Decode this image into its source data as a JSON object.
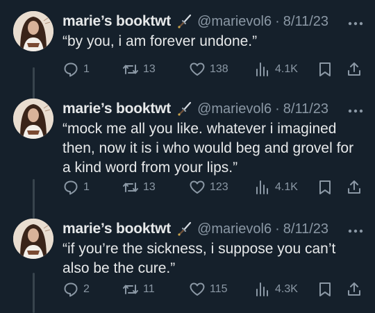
{
  "tweets": [
    {
      "display_name": "marie’s booktwt",
      "handle": "@marievol6",
      "separator": "·",
      "date": "8/11/23",
      "text": "“by you, i am forever undone.”",
      "replies": "1",
      "retweets": "13",
      "likes": "138",
      "views": "4.1K"
    },
    {
      "display_name": "marie’s booktwt",
      "handle": "@marievol6",
      "separator": "·",
      "date": "8/11/23",
      "text": "“mock me all you like. whatever i imagined then, now it is i who would beg and grovel for a kind word from your lips.”",
      "replies": "1",
      "retweets": "13",
      "likes": "123",
      "views": "4.1K"
    },
    {
      "display_name": "marie’s booktwt",
      "handle": "@marievol6",
      "separator": "·",
      "date": "8/11/23",
      "text": "“if you’re the sickness, i suppose you can’t also be the cure.”",
      "replies": "2",
      "retweets": "11",
      "likes": "115",
      "views": "4.3K"
    }
  ],
  "icons": {
    "verified_emoji": "dagger-icon",
    "more": "more-icon",
    "reply": "reply-icon",
    "retweet": "retweet-icon",
    "like": "heart-icon",
    "views": "views-icon",
    "bookmark": "bookmark-icon",
    "share": "share-icon"
  },
  "colors": {
    "background": "#15202b",
    "primary_text": "#e7e9ea",
    "secondary_text": "#8b98a5",
    "thread_line": "#38444d"
  }
}
